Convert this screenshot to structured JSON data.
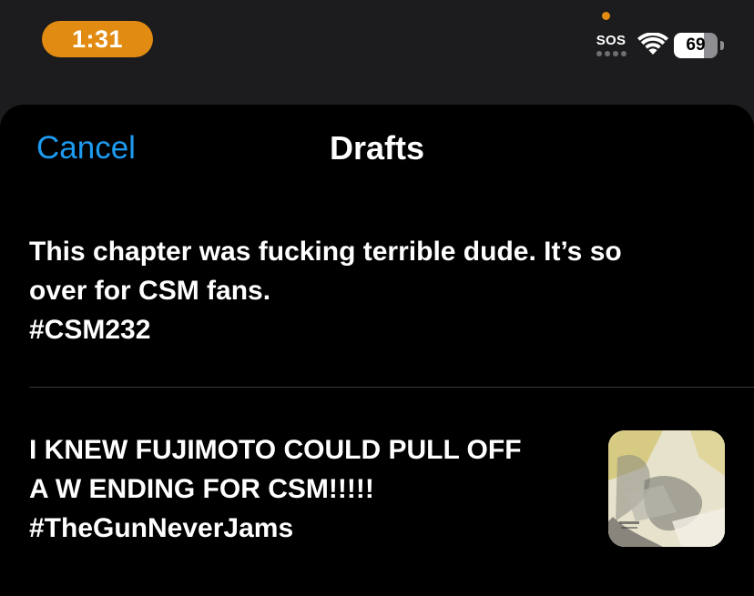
{
  "status_bar": {
    "time": "1:31",
    "sos": "SOS",
    "battery_level": "69",
    "battery_fraction": 0.69,
    "accent_color": "#e28b13"
  },
  "sheet": {
    "cancel_label": "Cancel",
    "title": "Drafts",
    "link_color": "#1d9bf0"
  },
  "drafts": [
    {
      "text": "This chapter was fucking terrible dude. It’s so\nover for CSM fans.\n#CSM232"
    },
    {
      "text": "I KNEW FUJIMOTO COULD PULL OFF\nA W ENDING FOR CSM!!!!!\n#TheGunNeverJams",
      "thumbnail_icon": "manga-panel-image"
    }
  ],
  "icons": {
    "wifi": "wifi-icon",
    "battery": "battery-icon",
    "privacy": "privacy-dot-icon"
  }
}
